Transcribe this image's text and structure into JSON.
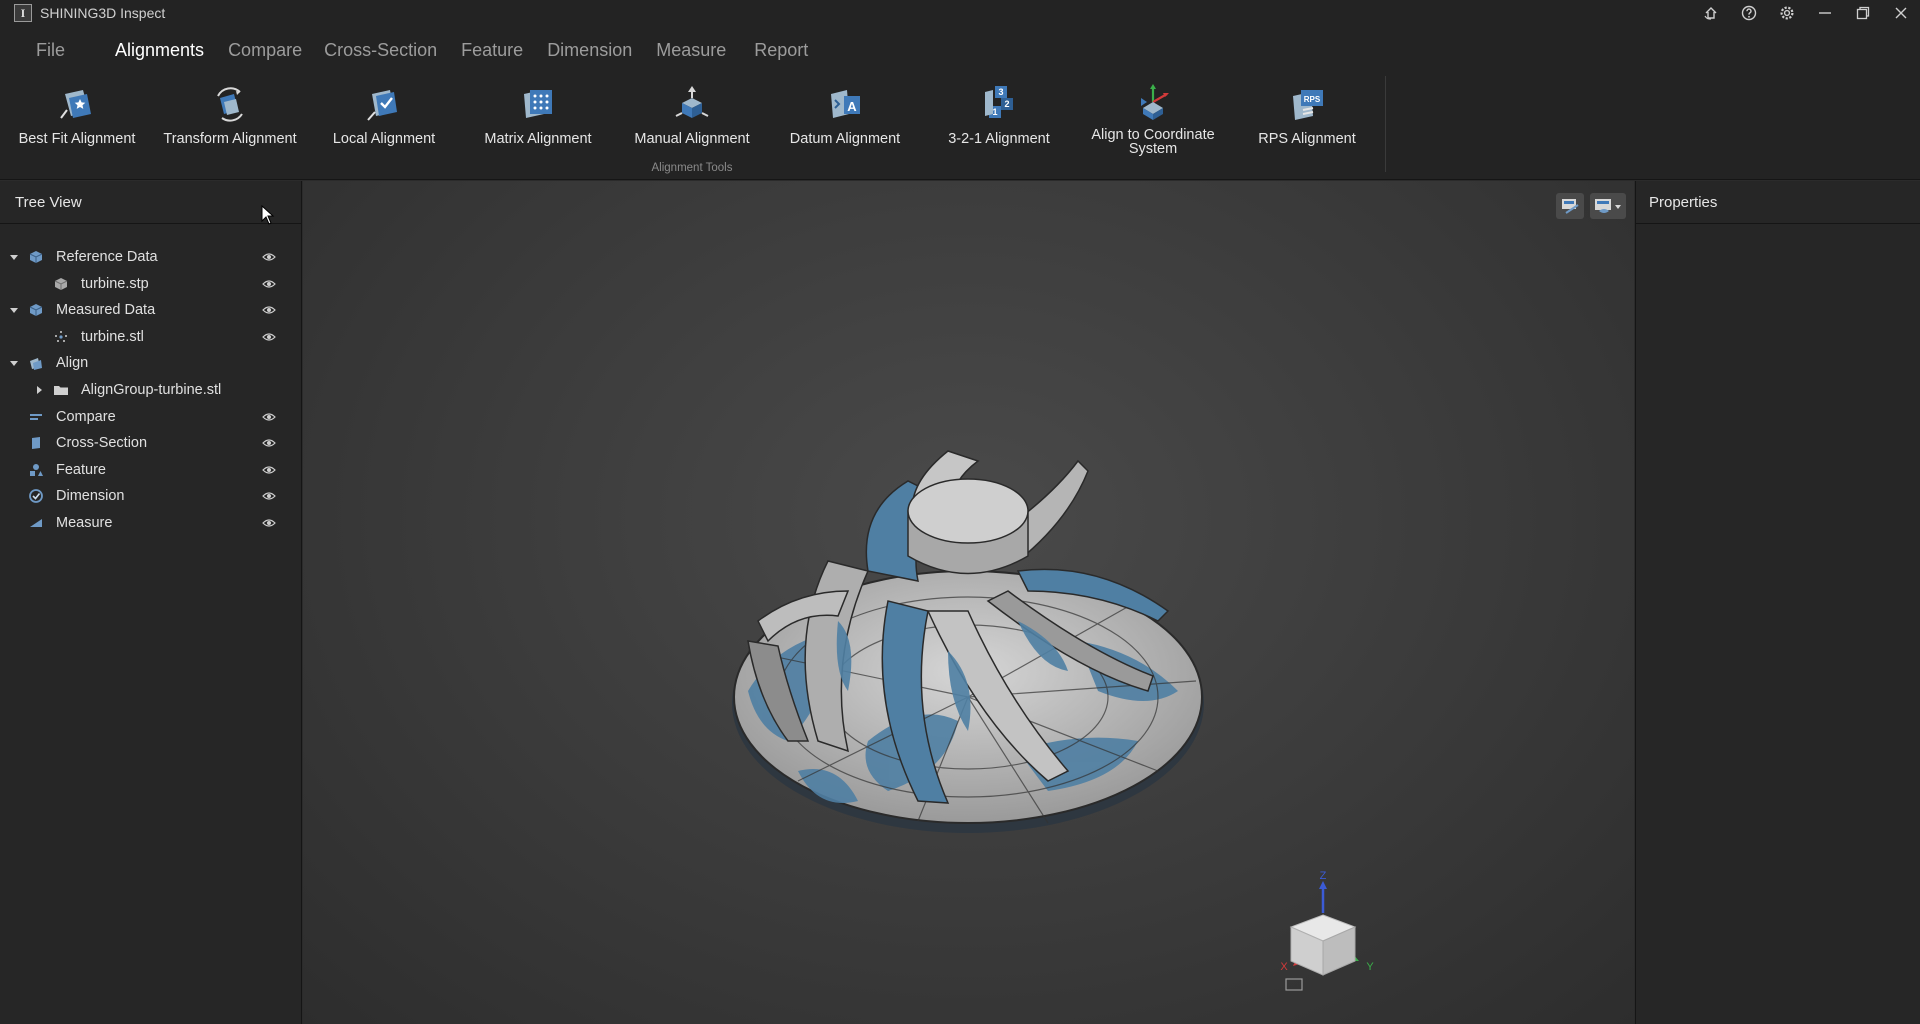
{
  "titlebar": {
    "logo_letter": "I",
    "title": "SHINING3D Inspect"
  },
  "menu": [
    {
      "label": "File",
      "active": false
    },
    {
      "label": "Alignments",
      "active": true
    },
    {
      "label": "Compare",
      "active": false
    },
    {
      "label": "Cross-Section",
      "active": false
    },
    {
      "label": "Feature",
      "active": false
    },
    {
      "label": "Dimension",
      "active": false
    },
    {
      "label": "Measure",
      "active": false
    },
    {
      "label": "Report",
      "active": false
    }
  ],
  "ribbon": {
    "group_label": "Alignment Tools",
    "tools": [
      {
        "label": "Best Fit Alignment",
        "icon": "best-fit-alignment-icon"
      },
      {
        "label": "Transform Alignment",
        "icon": "transform-alignment-icon"
      },
      {
        "label": "Local Alignment",
        "icon": "local-alignment-icon"
      },
      {
        "label": "Matrix Alignment",
        "icon": "matrix-alignment-icon"
      },
      {
        "label": "Manual Alignment",
        "icon": "manual-alignment-icon"
      },
      {
        "label": "Datum Alignment",
        "icon": "datum-alignment-icon"
      },
      {
        "label": "3-2-1 Alignment",
        "icon": "three-two-one-alignment-icon"
      },
      {
        "label": "Align to Coordinate System",
        "icon": "coordinate-system-alignment-icon"
      },
      {
        "label": "RPS Alignment",
        "icon": "rps-alignment-icon"
      }
    ],
    "icon_text": {
      "datum": "A",
      "rps": "RPS",
      "n1": "1",
      "n2": "2",
      "n3": "3"
    }
  },
  "tree": {
    "header": "Tree View",
    "items": [
      {
        "label": "Reference Data",
        "icon": "reference-data-icon",
        "expanded": true
      },
      {
        "label": "turbine.stp",
        "icon": "cad-part-icon"
      },
      {
        "label": "Measured Data",
        "icon": "measured-data-icon",
        "expanded": true
      },
      {
        "label": "turbine.stl",
        "icon": "point-cloud-icon"
      },
      {
        "label": "Align",
        "icon": "align-icon",
        "expanded": true
      },
      {
        "label": "AlignGroup-turbine.stl",
        "icon": "folder-icon",
        "expanded": false
      },
      {
        "label": "Compare",
        "icon": "compare-icon"
      },
      {
        "label": "Cross-Section",
        "icon": "cross-section-icon"
      },
      {
        "label": "Feature",
        "icon": "feature-icon"
      },
      {
        "label": "Dimension",
        "icon": "dimension-icon"
      },
      {
        "label": "Measure",
        "icon": "measure-icon"
      }
    ]
  },
  "properties": {
    "header": "Properties"
  },
  "viewport": {
    "axes": {
      "z": "Z",
      "y": "Y",
      "x": "X"
    },
    "colors": {
      "deviation_blue": "#4f7fa3",
      "surface_gray": "#b9b9b9",
      "axis_x": "#d23a3a",
      "axis_y": "#3bb04a",
      "axis_z": "#3b5bd6"
    }
  }
}
